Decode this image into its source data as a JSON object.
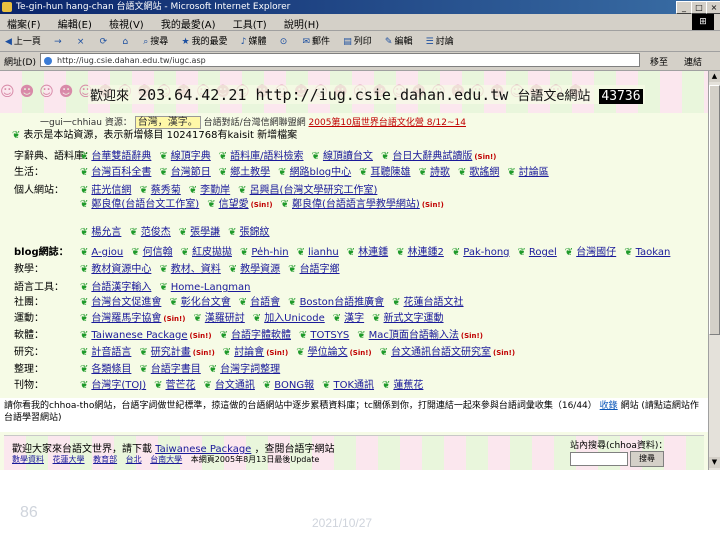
{
  "window": {
    "title": "Te-gin-hun hang-chan 台語文網站 - Microsoft Internet Explorer",
    "controls": [
      "_",
      "□",
      "×"
    ]
  },
  "menu": [
    "檔案(F)",
    "編輯(E)",
    "檢視(V)",
    "我的最愛(A)",
    "工具(T)",
    "說明(H)"
  ],
  "toolbar": [
    "上一頁",
    "→",
    "×",
    "⟳",
    "⌂",
    "搜尋",
    "我的最愛",
    "媒體",
    "⊙",
    "郵件",
    "列印",
    "編輯",
    "討論"
  ],
  "address": {
    "label": "網址(D)",
    "url": "http://iug.csie.dahan.edu.tw/iugc.asp",
    "go": "移至",
    "links": "連結"
  },
  "banner": {
    "people": "☺☻☺☻☺☻☺☻☺☻☺☻☺☻☺☻☺☻☺☻☺☻☺☻☺☻☺☻☺☻",
    "welcome": "歡迎來",
    "ip": "203.64.42.21",
    "url": "http://iug.csie.dahan.edu.tw",
    "site": "台語文e網站",
    "counter": "43736"
  },
  "notes": {
    "line1_prefix": "一gui一chhiau 資源：",
    "line1_highlight": "台灣，漢字。",
    "line1_mid": "台語對話/台灣信網聯盟網",
    "line1_red": "2005第10屆世界台語文化營 8/12~14",
    "line2": "表示是本站資源，表示新增條目",
    "line2_mid": "10241768有kaisit 新增檔案",
    "line2_date": ""
  },
  "rows": [
    {
      "cat": "字辭典、語料庫：",
      "items": [
        "台華雙語辭典",
        "線頂字典",
        "語料庫/語料檢索",
        "線頂讀台文",
        "台日大辭典試讀版"
      ],
      "sin": [
        4
      ]
    },
    {
      "cat": "生活：",
      "items": [
        "台灣百科全書",
        "台灣節日",
        "鄉土教學",
        "網路blog中心",
        "耳聽陳雄",
        "詩歌",
        "歌謠網",
        "討論區"
      ],
      "sin": []
    },
    {
      "cat": "個人網站：",
      "items": [
        "莊光信網",
        "蔡秀菊",
        "李勤岸",
        "呂興昌(台灣文學研究工作室)"
      ],
      "sin": []
    },
    {
      "cat": "",
      "items": [
        "鄭良偉(台語台文工作室)",
        "信望愛",
        "鄭良偉(台語語言學教學網站)"
      ],
      "sin": [
        1,
        2
      ]
    },
    {
      "cat": "",
      "items": [
        "楊允言",
        "范俊杰",
        "張學謙",
        "張錦紋"
      ],
      "sin": []
    },
    {
      "cat": "blog網誌：",
      "items": [
        "A-giou",
        "何信翰",
        "紅皮拋拋",
        "Pe̍h-hin",
        "lianhu",
        "林連鍾",
        "林連鍾2",
        "Pak-hong",
        "Rogel",
        "台灣國仔",
        "Taokan"
      ],
      "sin": []
    },
    {
      "cat": "教學：",
      "items": [
        "教材資源中心",
        "教材、資料",
        "教學資源",
        "台語字鄉"
      ],
      "sin": []
    },
    {
      "cat": "語言工具：",
      "items": [
        "台語漢字輸入",
        "Home-Langman"
      ],
      "sin": []
    },
    {
      "cat": "社團：",
      "items": [
        "台灣台文促進會",
        "彰化台文會",
        "台語會",
        "Boston台語推廣會",
        "花蓮台語文社"
      ],
      "sin": []
    },
    {
      "cat": "運動：",
      "items": [
        "台灣羅馬字協會",
        "漢羅研討",
        "加入Unicode",
        "漢字",
        "新式文字運動"
      ],
      "sin": [
        0
      ]
    },
    {
      "cat": "軟體：",
      "items": [
        "Taiwanese Package",
        "台語字體軟體",
        "TOTSYS",
        "Mac頂面台語輸入法"
      ],
      "sin": [
        0,
        3
      ]
    },
    {
      "cat": "研究：",
      "items": [
        "計音語言",
        "研究計畫",
        "討論會",
        "學位論文",
        "台文通訊台語文研究室"
      ],
      "sin": [
        1,
        2,
        3,
        4
      ]
    },
    {
      "cat": "整理：",
      "items": [
        "各類條目",
        "台語字書目",
        "台灣字詞整理"
      ],
      "sin": []
    },
    {
      "cat": "刊物：",
      "items": [
        "台灣字(TOJ)",
        "菅芒花",
        "台文通訊",
        "BONG報",
        "TOK通訊",
        "蓮蕉花"
      ],
      "sin": []
    }
  ],
  "bottom": {
    "text": "請你看我的chhoa-tho網站，台語字詞做世紀標準，掠這做的台語網站中逐步累積資料庫；tc關係到你，打開連結一起來參與台語詞彙收集（16/44）",
    "link": "收錄",
    "text2": "網站 (請點這網站作台語學習網站)"
  },
  "footer": {
    "line1_prefix": "歡迎大家來台語文世界，請下載",
    "line1_link": "Taiwanese Package",
    "line1_mid": "，查閱台語字網站",
    "line2_links": [
      "數學資料",
      "花蓮大學",
      "教育部",
      "台北",
      "台南大學"
    ],
    "line2_text": "本網頁2005年8月13日最後Update",
    "search_label": "站內搜尋(chhoa資料)：",
    "search_button": "搜尋"
  },
  "slide": {
    "page_number": "86",
    "date": "2021/10/27"
  }
}
